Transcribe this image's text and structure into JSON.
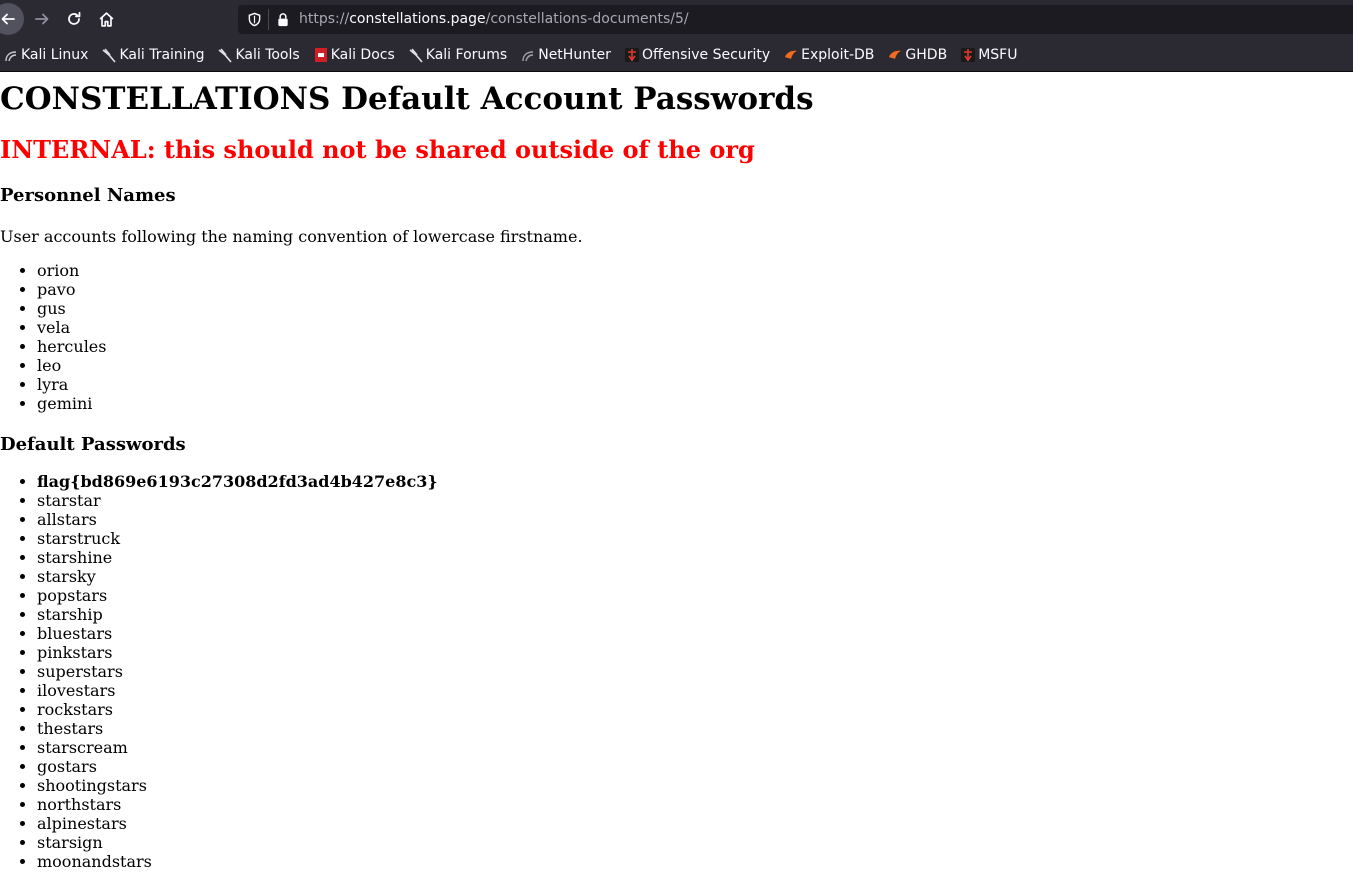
{
  "browser": {
    "url": {
      "scheme": "https://",
      "domain": "constellations.page",
      "path": "/constellations-documents/5/"
    },
    "bookmarks": [
      {
        "label": "Kali Linux",
        "icon": "kali-dragon-icon"
      },
      {
        "label": "Kali Training",
        "icon": "kali-dragon-icon"
      },
      {
        "label": "Kali Tools",
        "icon": "kali-dragon-icon"
      },
      {
        "label": "Kali Docs",
        "icon": "kali-docs-icon"
      },
      {
        "label": "Kali Forums",
        "icon": "kali-dragon-icon"
      },
      {
        "label": "NetHunter",
        "icon": "nethunter-icon"
      },
      {
        "label": "Offensive Security",
        "icon": "offsec-icon"
      },
      {
        "label": "Exploit-DB",
        "icon": "exploitdb-icon"
      },
      {
        "label": "GHDB",
        "icon": "exploitdb-icon"
      },
      {
        "label": "MSFU",
        "icon": "offsec-icon"
      }
    ]
  },
  "page": {
    "title": "CONSTELLATIONS Default Account Passwords",
    "warning": "INTERNAL: this should not be shared outside of the org",
    "personnel": {
      "heading": "Personnel Names",
      "description": "User accounts following the naming convention of lowercase firstname.",
      "names": [
        "orion",
        "pavo",
        "gus",
        "vela",
        "hercules",
        "leo",
        "lyra",
        "gemini"
      ]
    },
    "passwords": {
      "heading": "Default Passwords",
      "flag": "flag{bd869e6193c27308d2fd3ad4b427e8c3}",
      "items": [
        "starstar",
        "allstars",
        "starstruck",
        "starshine",
        "starsky",
        "popstars",
        "starship",
        "bluestars",
        "pinkstars",
        "superstars",
        "ilovestars",
        "rockstars",
        "thestars",
        "starscream",
        "gostars",
        "shootingstars",
        "northstars",
        "alpinestars",
        "starsign",
        "moonandstars"
      ]
    }
  },
  "colors": {
    "chrome_bg": "#2b2a33",
    "urlbar_bg": "#1c1b22",
    "warning": "#ff0000"
  }
}
